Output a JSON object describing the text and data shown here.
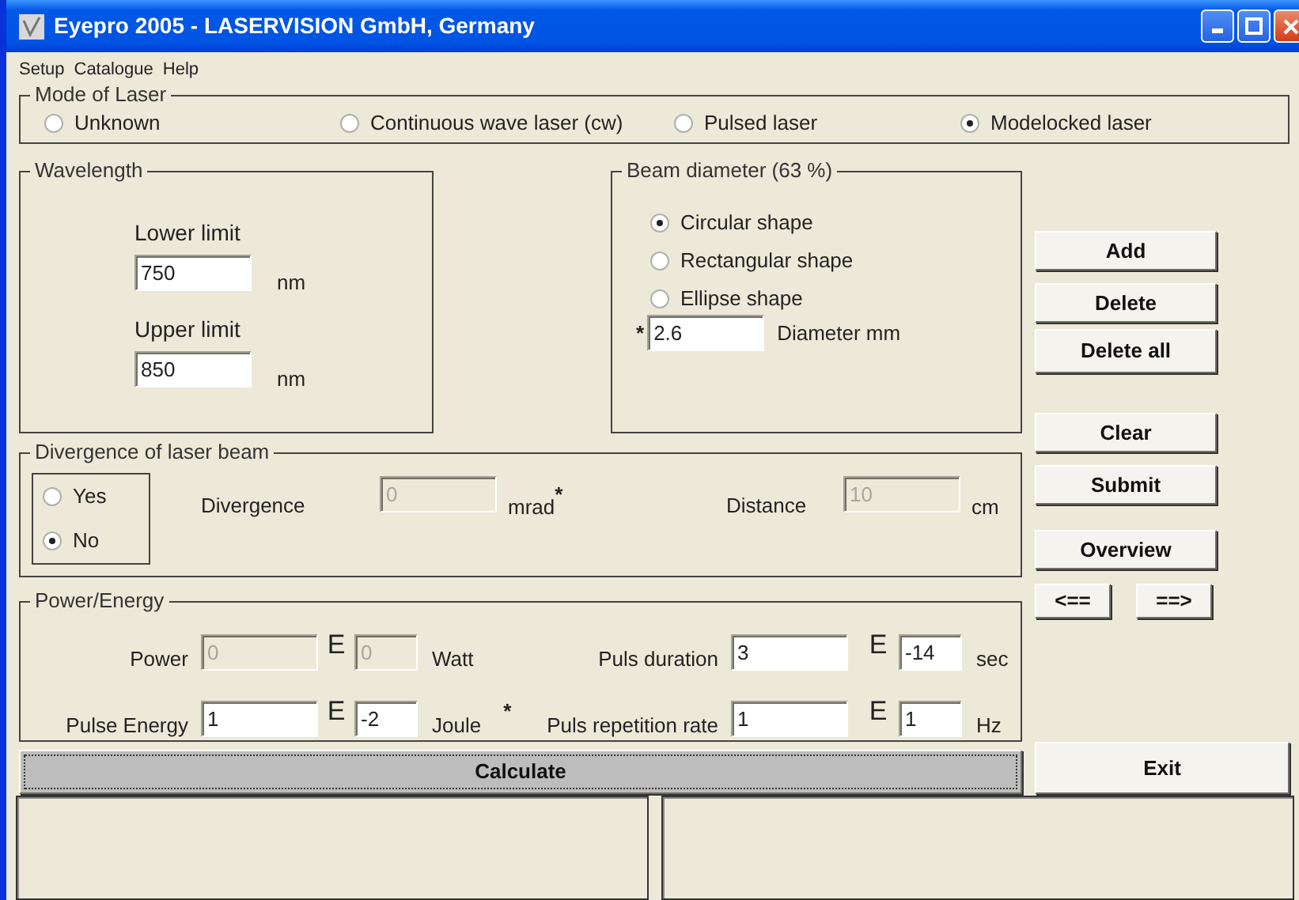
{
  "window": {
    "title": "Eyepro 2005 - LASERVISION GmbH, Germany"
  },
  "menu": [
    "Setup",
    "Catalogue",
    "Help"
  ],
  "mode_of_laser": {
    "title": "Mode of Laser",
    "options": [
      {
        "label": "Unknown",
        "selected": false
      },
      {
        "label": "Continuous wave laser (cw)",
        "selected": false
      },
      {
        "label": "Pulsed laser",
        "selected": false
      },
      {
        "label": "Modelocked laser",
        "selected": true
      }
    ]
  },
  "wavelength": {
    "title": "Wavelength",
    "fields": [
      {
        "label": "Lower limit",
        "value": "750",
        "unit": "nm"
      },
      {
        "label": "Upper limit",
        "value": "850",
        "unit": "nm"
      }
    ]
  },
  "beam_diameter": {
    "title": "Beam diameter (63 %)",
    "shapes": [
      {
        "label": "Circular shape",
        "selected": true
      },
      {
        "label": "Rectangular shape",
        "selected": false
      },
      {
        "label": "Ellipse shape",
        "selected": false
      }
    ],
    "mark": "*",
    "value": "2.6",
    "label": "Diameter mm"
  },
  "divergence": {
    "title": "Divergence of laser beam",
    "options": [
      {
        "label": "Yes",
        "selected": false
      },
      {
        "label": "No",
        "selected": true
      }
    ],
    "fields": [
      {
        "label": "Divergence",
        "value": "0",
        "disabled": true,
        "unit": "mrad",
        "mark": "*"
      },
      {
        "label": "Distance",
        "value": "10",
        "disabled": true,
        "unit": "cm"
      }
    ]
  },
  "power_energy": {
    "title": "Power/Energy",
    "quantities": [
      {
        "label": "Power",
        "value": "0",
        "exponent_sign": "E",
        "exponent": "0",
        "disabled": true,
        "unit": "Watt"
      },
      {
        "label": "Puls duration",
        "value": "3",
        "exponent_sign": "E",
        "exponent": "-14",
        "disabled": false,
        "unit": "sec"
      },
      {
        "label": "Pulse Energy",
        "value": "1",
        "exponent_sign": "E",
        "exponent": "-2",
        "disabled": false,
        "unit": "Joule",
        "mark": "*"
      },
      {
        "label": "Puls repetition rate",
        "value": "1",
        "exponent_sign": "E",
        "exponent": "1",
        "disabled": false,
        "unit": "Hz"
      }
    ]
  },
  "side_buttons": [
    "Add",
    "Delete",
    "Delete all",
    "Clear",
    "Submit",
    "Overview"
  ],
  "nav_buttons": [
    "<==",
    "==>"
  ],
  "calculate_button": "Calculate",
  "exit_button": "Exit"
}
